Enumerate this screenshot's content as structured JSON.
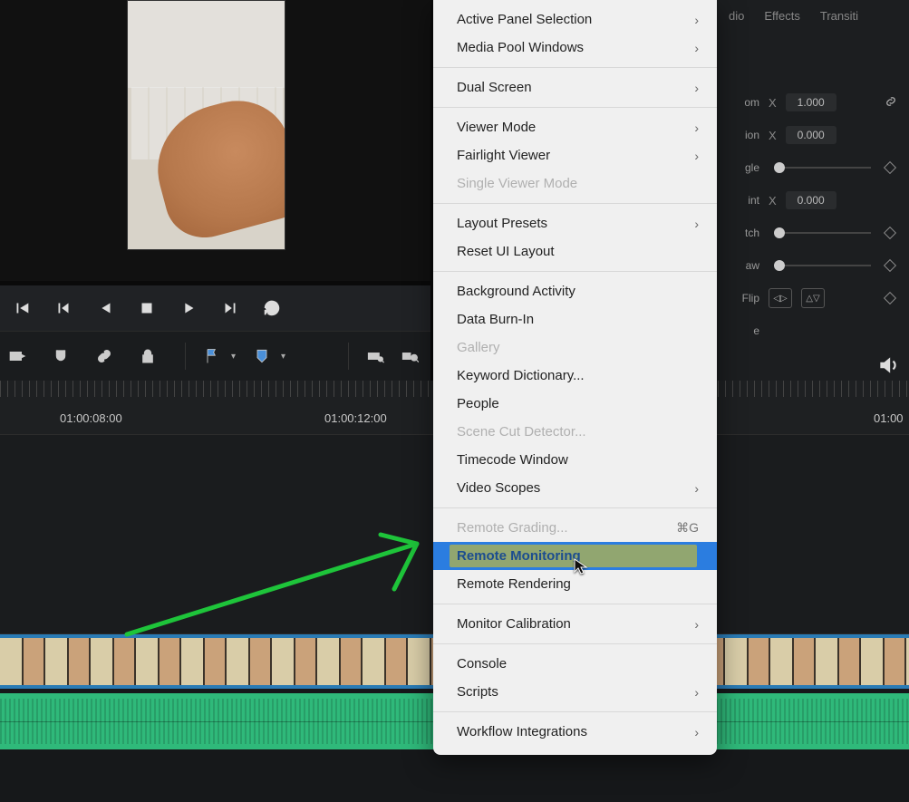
{
  "transport": {
    "tooltip_first": "first-frame",
    "tooltip_prev": "prev-clip",
    "tooltip_play_rev": "play-reverse",
    "tooltip_stop": "stop",
    "tooltip_play": "play",
    "tooltip_next": "next-clip",
    "tooltip_loop": "loop"
  },
  "ruler": {
    "tc1": "01:00:08:00",
    "tc2": "01:00:12:00",
    "tc3": "01:00"
  },
  "inspector": {
    "tabs": {
      "audio": "dio",
      "effects": "Effects",
      "transition": "Transiti"
    },
    "rows": {
      "zoom_label": "om",
      "zoom_axis": "X",
      "zoom_value": "1.000",
      "position_label": "ion",
      "position_axis": "X",
      "position_value": "0.000",
      "angle_label": "gle",
      "anchor_label": "int",
      "anchor_axis": "X",
      "anchor_value": "0.000",
      "pitch_label": "tch",
      "yaw_label": "aw",
      "flip_label": "Flip",
      "e_label": "e"
    }
  },
  "menu": {
    "items": [
      {
        "label": "Active Panel Selection",
        "submenu": true
      },
      {
        "label": "Media Pool Windows",
        "submenu": true
      },
      {
        "sep": true
      },
      {
        "label": "Dual Screen",
        "submenu": true
      },
      {
        "sep": true
      },
      {
        "label": "Viewer Mode",
        "submenu": true
      },
      {
        "label": "Fairlight Viewer",
        "submenu": true
      },
      {
        "label": "Single Viewer Mode",
        "disabled": true
      },
      {
        "sep": true
      },
      {
        "label": "Layout Presets",
        "submenu": true
      },
      {
        "label": "Reset UI Layout"
      },
      {
        "sep": true
      },
      {
        "label": "Background Activity"
      },
      {
        "label": "Data Burn-In"
      },
      {
        "label": "Gallery",
        "disabled": true
      },
      {
        "label": "Keyword Dictionary..."
      },
      {
        "label": "People"
      },
      {
        "label": "Scene Cut Detector...",
        "disabled": true
      },
      {
        "label": "Timecode Window"
      },
      {
        "label": "Video Scopes",
        "submenu": true
      },
      {
        "sep": true
      },
      {
        "label": "Remote Grading...",
        "disabled": true,
        "shortcut": "⌘G"
      },
      {
        "label": "Remote Monitoring",
        "highlighted": true,
        "yellowmark": true
      },
      {
        "label": "Remote Rendering"
      },
      {
        "sep": true
      },
      {
        "label": "Monitor Calibration",
        "submenu": true
      },
      {
        "sep": true
      },
      {
        "label": "Console"
      },
      {
        "label": "Scripts",
        "submenu": true
      },
      {
        "sep": true
      },
      {
        "label": "Workflow Integrations",
        "submenu": true
      }
    ]
  }
}
